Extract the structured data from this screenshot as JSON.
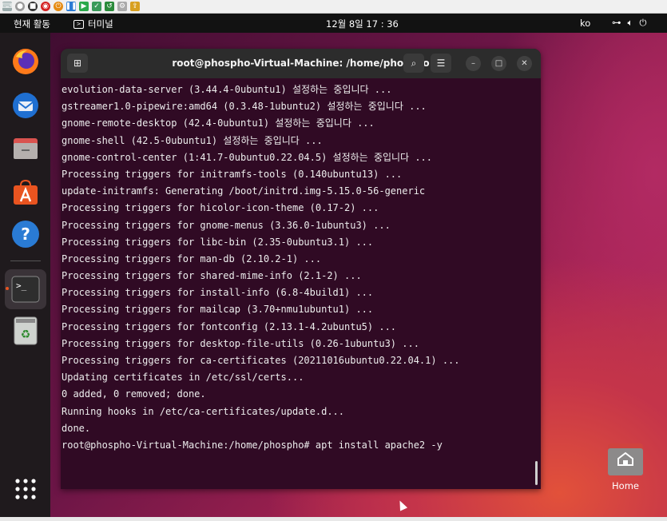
{
  "topbar": {
    "activities": "현재 활동",
    "app_name": "터미널",
    "clock": "12월 8일  17 : 36",
    "lang": "ko"
  },
  "terminal": {
    "title": "root@phospho-Virtual-Machine: /home/phospho",
    "lines": [
      "evolution-data-server (3.44.4-0ubuntu1) 설정하는 중입니다 ...",
      "gstreamer1.0-pipewire:amd64 (0.3.48-1ubuntu2) 설정하는 중입니다 ...",
      "gnome-remote-desktop (42.4-0ubuntu1) 설정하는 중입니다 ...",
      "gnome-shell (42.5-0ubuntu1) 설정하는 중입니다 ...",
      "gnome-control-center (1:41.7-0ubuntu0.22.04.5) 설정하는 중입니다 ...",
      "Processing triggers for initramfs-tools (0.140ubuntu13) ...",
      "update-initramfs: Generating /boot/initrd.img-5.15.0-56-generic",
      "Processing triggers for hicolor-icon-theme (0.17-2) ...",
      "Processing triggers for gnome-menus (3.36.0-1ubuntu3) ...",
      "Processing triggers for libc-bin (2.35-0ubuntu3.1) ...",
      "Processing triggers for man-db (2.10.2-1) ...",
      "Processing triggers for shared-mime-info (2.1-2) ...",
      "Processing triggers for install-info (6.8-4build1) ...",
      "Processing triggers for mailcap (3.70+nmu1ubuntu1) ...",
      "Processing triggers for fontconfig (2.13.1-4.2ubuntu5) ...",
      "Processing triggers for desktop-file-utils (0.26-1ubuntu3) ...",
      "Processing triggers for ca-certificates (20211016ubuntu0.22.04.1) ...",
      "Updating certificates in /etc/ssl/certs...",
      "0 added, 0 removed; done.",
      "Running hooks in /etc/ca-certificates/update.d...",
      "done.",
      "root@phospho-Virtual-Machine:/home/phospho# apt install apache2 -y"
    ]
  },
  "desktop": {
    "home_label": "Home"
  },
  "colors": {
    "terminal_bg": "#300a24",
    "topbar_bg": "#121212",
    "accent": "#e95420"
  }
}
